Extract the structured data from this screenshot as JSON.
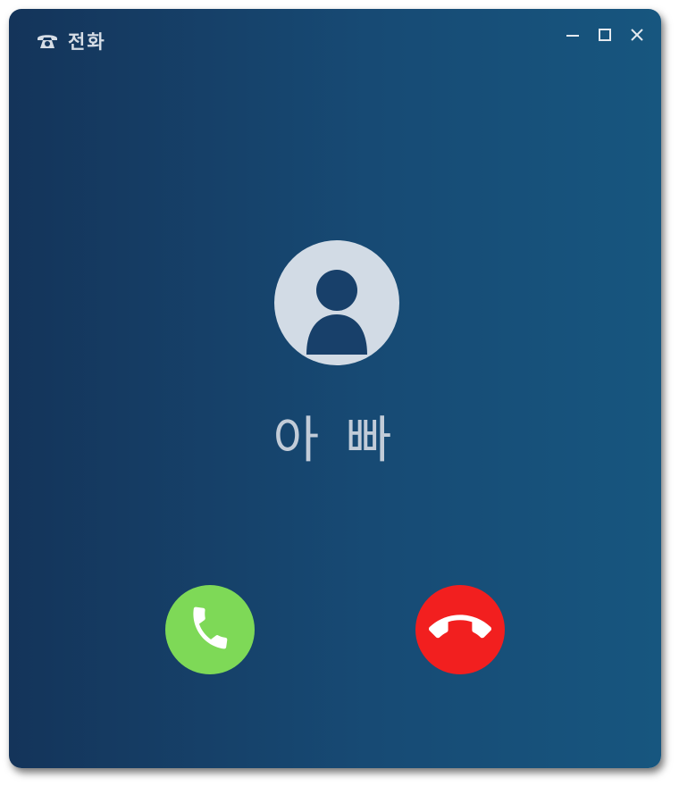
{
  "window": {
    "title": "전화",
    "icon": "telephone-icon",
    "controls": [
      "minimize-icon",
      "maximize-icon",
      "close-icon"
    ]
  },
  "call": {
    "caller_name": "아 빠",
    "avatar_icon": "user-avatar-icon",
    "accept_icon": "phone-accept-icon",
    "decline_icon": "phone-decline-icon"
  },
  "colors": {
    "background_start": "#14345a",
    "background_end": "#17567f",
    "accept": "#7ed957",
    "decline": "#f21f1f",
    "avatar": "#d2dbe5",
    "avatar_figure": "#18406a",
    "text": "#c2ccd8"
  }
}
